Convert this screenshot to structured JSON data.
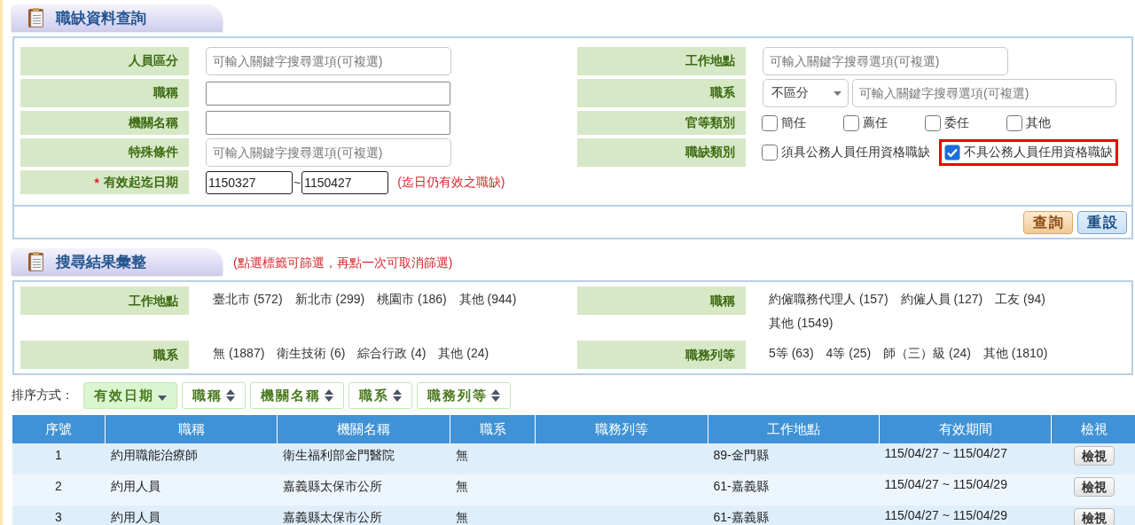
{
  "query": {
    "title": "職缺資料查詢",
    "fields": [
      {
        "label": "人員區分",
        "kind": "text",
        "placeholder": "可輸入關鍵字搜尋選項(可複選)"
      },
      {
        "label": "工作地點",
        "kind": "text",
        "placeholder": "可輸入關鍵字搜尋選項(可複選)"
      },
      {
        "label": "職稱",
        "kind": "text"
      },
      {
        "label": "職系",
        "kind": "select_text",
        "select_value": "不區分",
        "placeholder": "可輸入關鍵字搜尋選項(可複選)"
      },
      {
        "label": "機關名稱",
        "kind": "text"
      },
      {
        "label": "官等類別",
        "kind": "checkboxes",
        "options": [
          {
            "label": "簡任",
            "checked": false,
            "highlighted": false
          },
          {
            "label": "薦任",
            "checked": false,
            "highlighted": false
          },
          {
            "label": "委任",
            "checked": false,
            "highlighted": false
          },
          {
            "label": "其他",
            "checked": false,
            "highlighted": false
          }
        ]
      },
      {
        "label": "特殊條件",
        "kind": "text",
        "placeholder": "可輸入關鍵字搜尋選項(可複選)"
      },
      {
        "label": "職缺類別",
        "kind": "checkboxes",
        "options": [
          {
            "label": "須具公務人員任用資格職缺",
            "checked": false,
            "highlighted": false
          },
          {
            "label": "不具公務人員任用資格職缺",
            "checked": true,
            "highlighted": true
          }
        ]
      },
      {
        "label": "有效起迄日期",
        "kind": "date_range",
        "required_mark": "*",
        "from": "1150327",
        "separator": "~",
        "to": "1150427",
        "note": "(迄日仍有效之職缺)"
      }
    ],
    "buttons": [
      {
        "label": "查詢",
        "kind": "primary"
      },
      {
        "label": "重設",
        "kind": "secondary"
      }
    ]
  },
  "results": {
    "title": "搜尋結果彙整",
    "note": "(點選標籤可篩選，再點一次可取消篩選)",
    "facets": [
      {
        "label": "工作地點",
        "tags": [
          "臺北市 (572)",
          "新北市 (299)",
          "桃園市 (186)",
          "其他 (944)"
        ]
      },
      {
        "label": "職稱",
        "tags": [
          "約僱職務代理人 (157)",
          "約僱人員 (127)",
          "工友 (94)",
          "其他 (1549)"
        ]
      },
      {
        "label": "職系",
        "tags": [
          "無 (1887)",
          "衛生技術 (6)",
          "綜合行政 (4)",
          "其他 (24)"
        ]
      },
      {
        "label": "職務列等",
        "tags": [
          "5等 (63)",
          "4等 (25)",
          "師（三）級 (24)",
          "其他 (1810)"
        ]
      }
    ]
  },
  "sort": {
    "label": "排序方式：",
    "options": [
      {
        "label": "有效日期",
        "selected": true
      },
      {
        "label": "職稱",
        "selected": false
      },
      {
        "label": "機關名稱",
        "selected": false
      },
      {
        "label": "職系",
        "selected": false
      },
      {
        "label": "職務列等",
        "selected": false
      }
    ]
  },
  "table": {
    "columns": [
      "序號",
      "職稱",
      "機關名稱",
      "職系",
      "職務列等",
      "工作地點",
      "有效期間",
      "檢視"
    ],
    "rows": [
      {
        "no": "1",
        "title": "約用職能治療師",
        "agency": "衛生福利部金門醫院",
        "series": "無",
        "location": "89-金門縣",
        "period": "115/04/27 ~ 115/04/27",
        "action": "檢視"
      },
      {
        "no": "2",
        "title": "約用人員",
        "agency": "嘉義縣太保市公所",
        "series": "無",
        "location": "61-嘉義縣",
        "period": "115/04/27 ~ 115/04/29",
        "action": "檢視"
      },
      {
        "no": "3",
        "title": "約用人員",
        "agency": "嘉義縣太保市公所",
        "series": "無",
        "location": "61-嘉義縣",
        "period": "115/04/27 ~ 115/04/29",
        "action": "檢視"
      }
    ]
  }
}
